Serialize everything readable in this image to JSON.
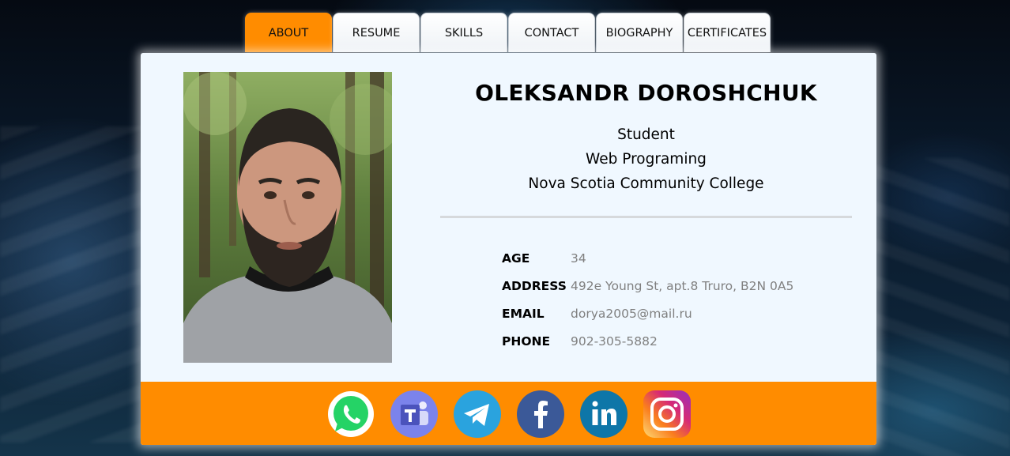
{
  "nav": {
    "tabs": [
      {
        "label": "ABOUT",
        "active": true
      },
      {
        "label": "RESUME",
        "active": false
      },
      {
        "label": "SKILLS",
        "active": false
      },
      {
        "label": "CONTACT",
        "active": false
      },
      {
        "label": "BIOGRAPHY",
        "active": false
      },
      {
        "label": "CERTIFICATES",
        "active": false
      }
    ]
  },
  "profile": {
    "name": "OLEKSANDR DOROSHCHUK",
    "subtitles": [
      "Student",
      "Web Programing",
      "Nova Scotia Community College"
    ],
    "details": [
      {
        "label": "AGE",
        "value": "34"
      },
      {
        "label": "ADDRESS",
        "value": "492e Young St, apt.8 Truro, B2N 0A5"
      },
      {
        "label": "EMAIL",
        "value": "dorya2005@mail.ru"
      },
      {
        "label": "PHONE",
        "value": "902-305-5882"
      }
    ]
  },
  "social": {
    "icons": [
      "whatsapp-icon",
      "teams-icon",
      "telegram-icon",
      "facebook-icon",
      "linkedin-icon",
      "instagram-icon"
    ]
  },
  "colors": {
    "accent": "#ff8c00",
    "card_background": "#f0f8ff",
    "value_text": "#808080",
    "whatsapp": "#25d366",
    "teams": "#5b5fc7",
    "telegram": "#2aa3de",
    "facebook": "#3b5998",
    "linkedin": "#0e76a8"
  }
}
